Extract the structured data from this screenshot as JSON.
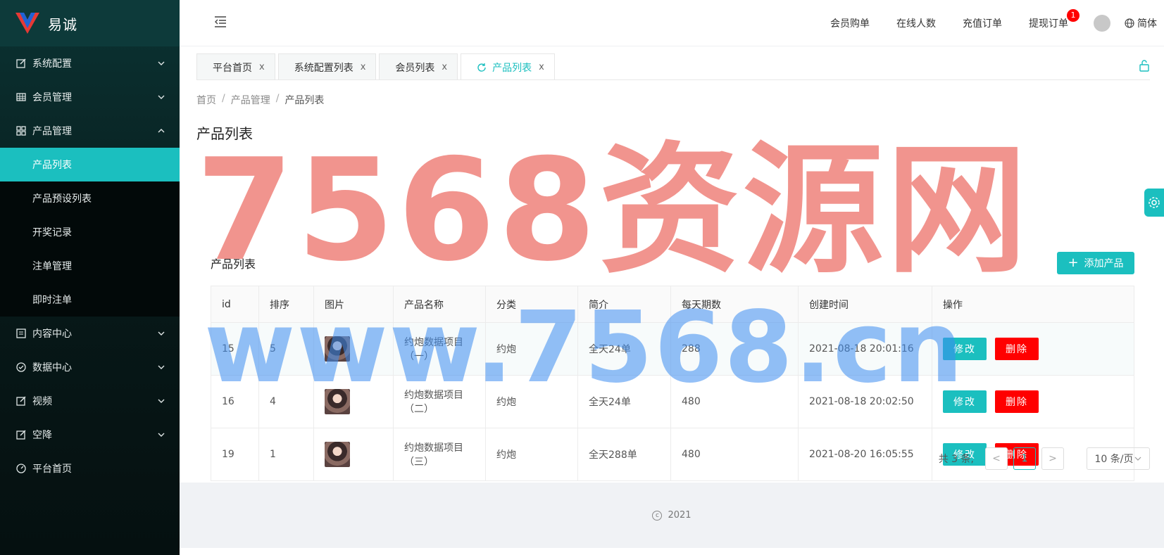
{
  "app": {
    "name": "易诚"
  },
  "sidebar": {
    "items": [
      {
        "label": "系统配置",
        "icon": "edit-icon"
      },
      {
        "label": "会员管理",
        "icon": "table-icon"
      },
      {
        "label": "产品管理",
        "icon": "grid-icon"
      },
      {
        "label": "内容中心",
        "icon": "list-icon"
      },
      {
        "label": "数据中心",
        "icon": "check-circle-icon"
      },
      {
        "label": "视频",
        "icon": "edit-icon"
      },
      {
        "label": "空降",
        "icon": "edit-icon"
      },
      {
        "label": "平台首页",
        "icon": "dashboard-icon"
      }
    ],
    "product_sub": [
      "产品列表",
      "产品预设列表",
      "开奖记录",
      "注单管理",
      "即时注单"
    ]
  },
  "header": {
    "links": [
      "会员购单",
      "在线人数",
      "充值订单",
      "提现订单"
    ],
    "withdraw_badge": "1",
    "lang": "简体"
  },
  "tabs": [
    {
      "label": "平台首页"
    },
    {
      "label": "系统配置列表"
    },
    {
      "label": "会员列表"
    },
    {
      "label": "产品列表"
    }
  ],
  "tab_close": "x",
  "breadcrumb": {
    "home": "首页",
    "parent": "产品管理",
    "current": "产品列表",
    "sep": "/"
  },
  "page_title": "产品列表",
  "card": {
    "title": "产品列表",
    "add_label": "添加产品",
    "add_plus": "+"
  },
  "table": {
    "columns": [
      "id",
      "排序",
      "图片",
      "产品名称",
      "分类",
      "简介",
      "每天期数",
      "创建时间",
      "操作"
    ],
    "rows": [
      {
        "id": "15",
        "sort": "5",
        "name_line1": "约炮数据项目",
        "name_line2": "（一）",
        "category": "约炮",
        "intro": "全天24单",
        "periods": "288",
        "created": "2021-08-18 20:01:16"
      },
      {
        "id": "16",
        "sort": "4",
        "name_line1": "约炮数据项目",
        "name_line2": "（二）",
        "category": "约炮",
        "intro": "全天24单",
        "periods": "480",
        "created": "2021-08-18 20:02:50"
      },
      {
        "id": "19",
        "sort": "1",
        "name_line1": "约炮数据项目",
        "name_line2": "（三）",
        "category": "约炮",
        "intro": "全天288单",
        "periods": "480",
        "created": "2021-08-20 16:05:55"
      }
    ],
    "edit_label": "修改",
    "delete_label": "删除"
  },
  "pager": {
    "total_text": "共 3 条,",
    "prev": "<",
    "page": "1",
    "next": ">",
    "size_text": "10 条/页"
  },
  "footer": {
    "copy_symbol": "c",
    "year": "2021"
  },
  "watermark": {
    "line1": "7568资源网",
    "line2": "www.7568.cn"
  },
  "colors": {
    "accent": "#1bbfbf",
    "danger": "#ff0000",
    "sidebar_bg": "#071818"
  }
}
